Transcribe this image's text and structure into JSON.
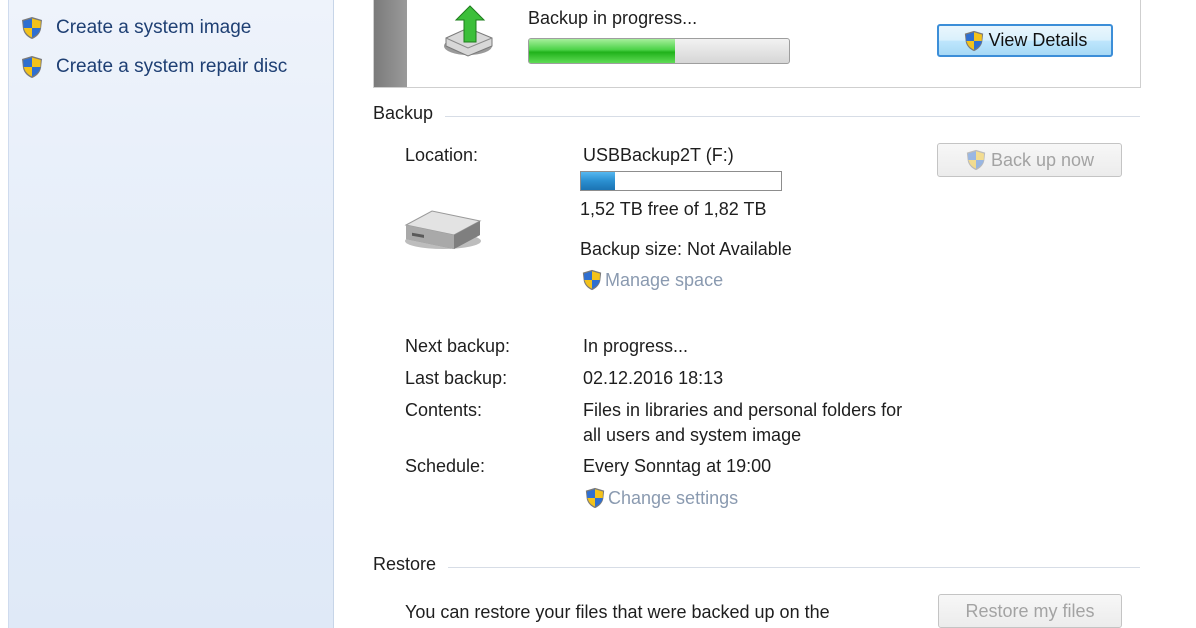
{
  "sidebar": {
    "links": [
      {
        "label": "Create a system image"
      },
      {
        "label": "Create a system repair disc"
      }
    ]
  },
  "progress": {
    "status": "Backup in progress...",
    "fraction": 0.56,
    "view_details_label": "View Details"
  },
  "backup": {
    "header": "Backup",
    "location_label": "Location:",
    "location_value": "USBBackup2T (F:)",
    "disk_used_fraction": 0.17,
    "free_text": "1,52 TB free of 1,82 TB",
    "backup_size": "Backup size: Not Available",
    "manage_space": "Manage space",
    "back_up_now": "Back up now",
    "next_label": "Next backup:",
    "next_value": "In progress...",
    "last_label": "Last backup:",
    "last_value": "02.12.2016 18:13",
    "contents_label": "Contents:",
    "contents_line1": "Files in libraries and personal folders for",
    "contents_line2": "all users and system image",
    "schedule_label": "Schedule:",
    "schedule_value": "Every Sonntag at 19:00",
    "change_settings": "Change settings"
  },
  "restore": {
    "header": "Restore",
    "text": "You can restore your files that were backed up on the",
    "restore_button": "Restore my files"
  },
  "icons": {
    "shield": "uac-shield-icon",
    "backup_progress": "backup-arrow-icon",
    "drive": "hard-drive-icon"
  },
  "colors": {
    "progress_green": "#21b21b",
    "disk_blue": "#2a8fd0",
    "link_blue": "#1e3f73",
    "disabled_gray": "#a3a3a3"
  }
}
